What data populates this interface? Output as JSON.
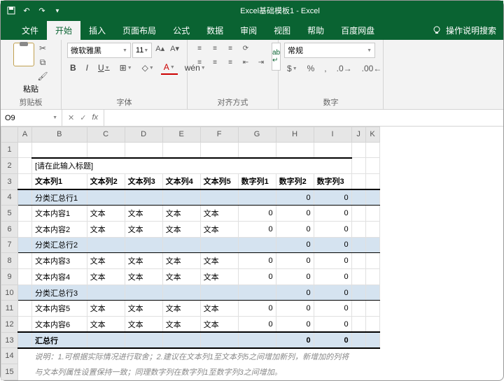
{
  "titlebar": {
    "title": "Excel基础模板1  -  Excel"
  },
  "tabs": [
    "文件",
    "开始",
    "插入",
    "页面布局",
    "公式",
    "数据",
    "审阅",
    "视图",
    "帮助",
    "百度网盘"
  ],
  "tellme": "操作说明搜索",
  "ribbon": {
    "paste": "粘贴",
    "clipboard": "剪贴板",
    "fontname": "微软雅黑",
    "fontsize": "11",
    "fontlabel": "字体",
    "bold": "B",
    "italic": "I",
    "underline": "U",
    "wen": "wén",
    "alignlabel": "对齐方式",
    "numfmt": "常规",
    "numlabel": "数字"
  },
  "namebox": "O9",
  "cols": [
    "A",
    "B",
    "C",
    "D",
    "E",
    "F",
    "G",
    "H",
    "I",
    "J",
    "K"
  ],
  "rownums": [
    1,
    2,
    3,
    4,
    5,
    6,
    7,
    8,
    9,
    10,
    11,
    12,
    13,
    14,
    15
  ],
  "table": {
    "title": "[请在此输入标题]",
    "headers": [
      "文本列1",
      "文本列2",
      "文本列3",
      "文本列4",
      "文本列5",
      "数字列1",
      "数字列2",
      "数字列3"
    ],
    "rows": [
      {
        "t": "sub",
        "c": [
          "分类汇总行1",
          "",
          "",
          "",
          "",
          "",
          "0",
          "0"
        ]
      },
      {
        "t": "d",
        "c": [
          "文本内容1",
          "文本",
          "文本",
          "文本",
          "文本",
          "0",
          "0",
          "0"
        ]
      },
      {
        "t": "d",
        "c": [
          "文本内容2",
          "文本",
          "文本",
          "文本",
          "文本",
          "0",
          "0",
          "0"
        ]
      },
      {
        "t": "sub",
        "c": [
          "分类汇总行2",
          "",
          "",
          "",
          "",
          "",
          "0",
          "0"
        ]
      },
      {
        "t": "d",
        "c": [
          "文本内容3",
          "文本",
          "文本",
          "文本",
          "文本",
          "0",
          "0",
          "0"
        ]
      },
      {
        "t": "d",
        "c": [
          "文本内容4",
          "文本",
          "文本",
          "文本",
          "文本",
          "0",
          "0",
          "0"
        ]
      },
      {
        "t": "sub",
        "c": [
          "分类汇总行3",
          "",
          "",
          "",
          "",
          "",
          "0",
          "0"
        ]
      },
      {
        "t": "d",
        "c": [
          "文本内容5",
          "文本",
          "文本",
          "文本",
          "文本",
          "0",
          "0",
          "0"
        ]
      },
      {
        "t": "d",
        "c": [
          "文本内容6",
          "文本",
          "文本",
          "文本",
          "文本",
          "0",
          "0",
          "0"
        ]
      },
      {
        "t": "total",
        "c": [
          "汇总行",
          "",
          "",
          "",
          "",
          "",
          "0",
          "0"
        ]
      }
    ],
    "note1": "说明：1.可根据实际情况进行取舍；2.建议在文本列1至文本列5之间增加新列，新增加的列将",
    "note2": "与文本列属性设置保持一致；同理数字列在数字列1至数字列3之间增加。"
  }
}
